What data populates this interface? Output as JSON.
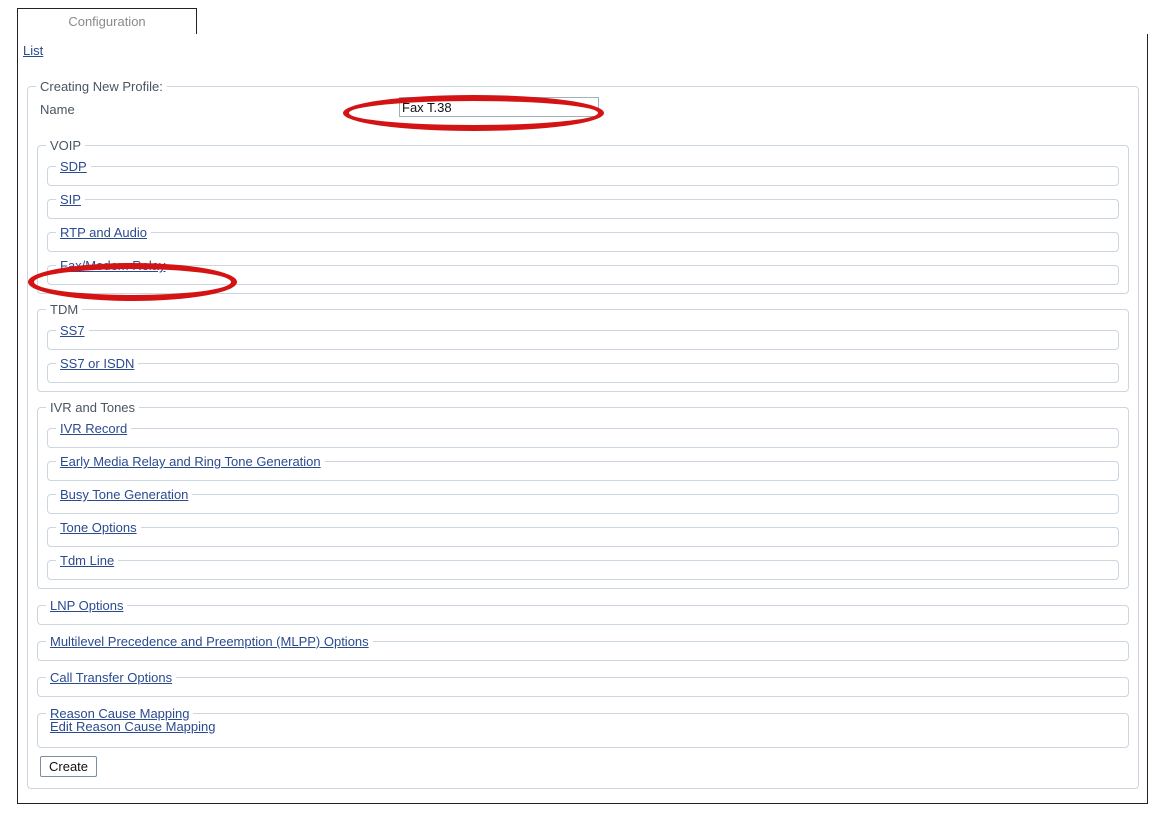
{
  "tab": {
    "label": "Configuration"
  },
  "breadcrumb": {
    "list_label": "List"
  },
  "form": {
    "legend": "Creating New Profile:",
    "name_label": "Name",
    "name_value": "Fax T.38",
    "name_placeholder": "",
    "create_label": "Create"
  },
  "groups": [
    {
      "legend": "VOIP",
      "items": [
        {
          "label": "SDP"
        },
        {
          "label": "SIP"
        },
        {
          "label": "RTP and Audio"
        },
        {
          "label": "Fax/Modem Relay"
        }
      ]
    },
    {
      "legend": "TDM",
      "items": [
        {
          "label": "SS7"
        },
        {
          "label": "SS7 or ISDN"
        }
      ]
    },
    {
      "legend": "IVR and Tones",
      "items": [
        {
          "label": "IVR Record"
        },
        {
          "label": "Early Media Relay and Ring Tone Generation"
        },
        {
          "label": "Busy Tone Generation"
        },
        {
          "label": "Tone Options"
        },
        {
          "label": "Tdm Line"
        }
      ]
    }
  ],
  "top_level_items": [
    {
      "label": "LNP Options"
    },
    {
      "label": "Multilevel Precedence and Preemption (MLPP) Options"
    },
    {
      "label": "Call Transfer Options"
    }
  ],
  "reason_cause_mapping": {
    "legend": "Reason Cause Mapping",
    "edit_label": "Edit Reason Cause Mapping"
  },
  "annotations": {
    "color": "#d41414",
    "items": [
      {
        "name": "name-field-highlight",
        "shape": "ellipse"
      },
      {
        "name": "fax-modem-relay-highlight",
        "shape": "ellipse"
      }
    ]
  },
  "colors": {
    "link": "#2b4b8f",
    "fieldset_border": "#ccd6e0",
    "page_border": "#222222",
    "label_text": "#4a5560",
    "tab_text": "#8a8a8a"
  }
}
